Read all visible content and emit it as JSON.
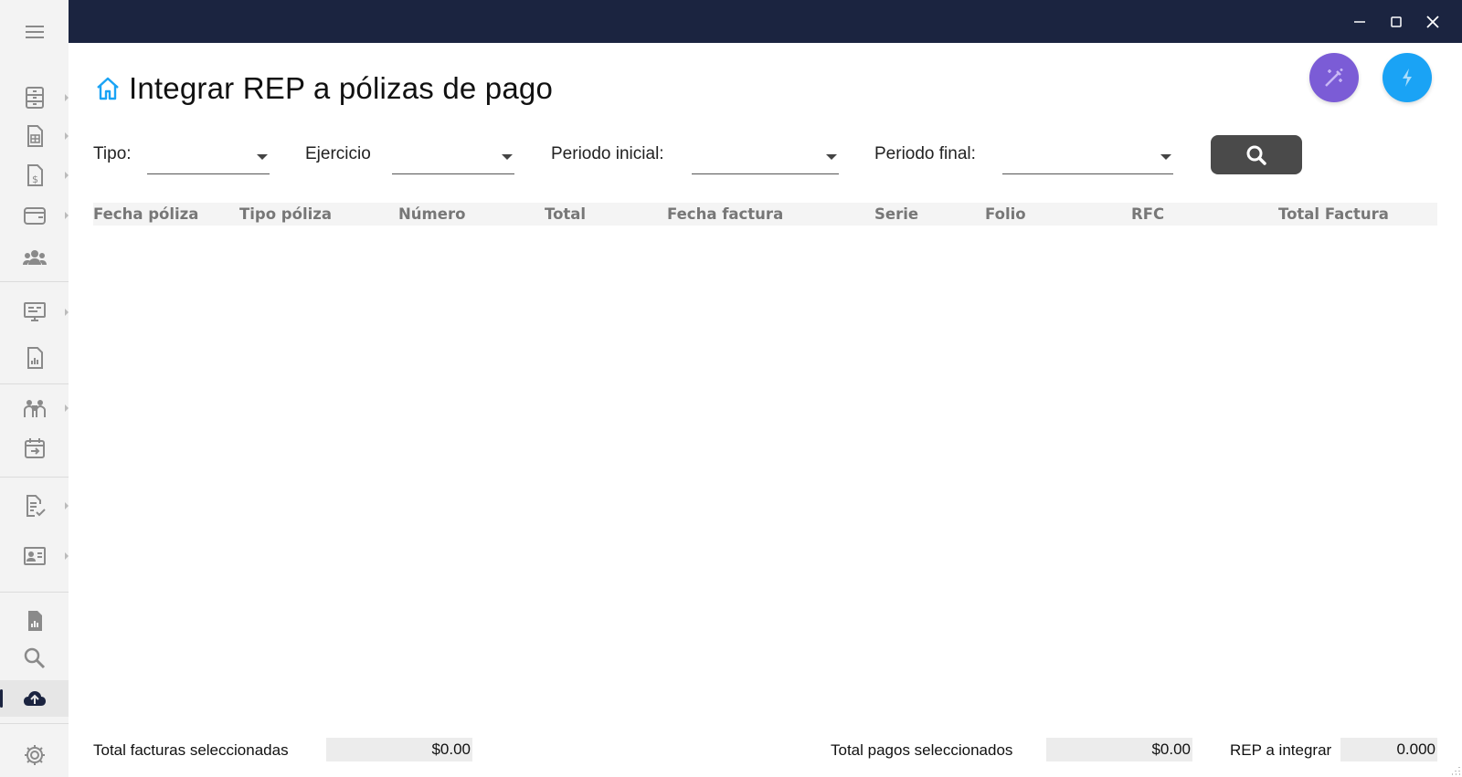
{
  "window": {
    "controls": {
      "minimize": "minimize-icon",
      "maximize": "maximize-icon",
      "close": "close-icon"
    },
    "titlebar_color": "#1b2440"
  },
  "sidebar": {
    "items": [
      {
        "name": "menu-icon"
      },
      {
        "name": "archive-cabinet-icon"
      },
      {
        "name": "spreadsheet-document-icon"
      },
      {
        "name": "invoice-dollar-icon"
      },
      {
        "name": "wallet-icon"
      },
      {
        "name": "users-group-icon"
      },
      {
        "name": "monitor-icon"
      },
      {
        "name": "report-chart-icon"
      },
      {
        "name": "team-collaboration-icon"
      },
      {
        "name": "calendar-transfer-icon"
      },
      {
        "name": "document-check-icon"
      },
      {
        "name": "id-card-icon"
      },
      {
        "name": "building-chart-icon"
      },
      {
        "name": "search-zoom-icon"
      },
      {
        "name": "cloud-upload-icon",
        "active": true
      },
      {
        "name": "gear-icon"
      }
    ]
  },
  "header": {
    "title": "Integrar REP a pólizas de pago",
    "home_icon": "home-icon",
    "actions": [
      {
        "name": "magic-wand-icon",
        "color": "#7b5cd6"
      },
      {
        "name": "lightning-bolt-icon",
        "color": "#1aa3f5"
      }
    ]
  },
  "filters": {
    "tipo_label": "Tipo:",
    "tipo_value": "",
    "ejercicio_label": "Ejercicio",
    "ejercicio_value": "",
    "periodo_inicial_label": "Periodo inicial:",
    "periodo_inicial_value": "",
    "periodo_final_label": "Periodo final:",
    "periodo_final_value": "",
    "search_button_icon": "search-icon"
  },
  "table": {
    "columns": [
      "Fecha póliza",
      "Tipo póliza",
      "Número",
      "Total",
      "Fecha factura",
      "Serie",
      "Folio",
      "RFC",
      "Total Factura"
    ],
    "rows": []
  },
  "footer": {
    "total_facturas_label": "Total facturas seleccionadas",
    "total_facturas_value": "$0.00",
    "total_pagos_label": "Total pagos seleccionados",
    "total_pagos_value": "$0.00",
    "rep_label": "REP a integrar",
    "rep_value": "0.000"
  }
}
